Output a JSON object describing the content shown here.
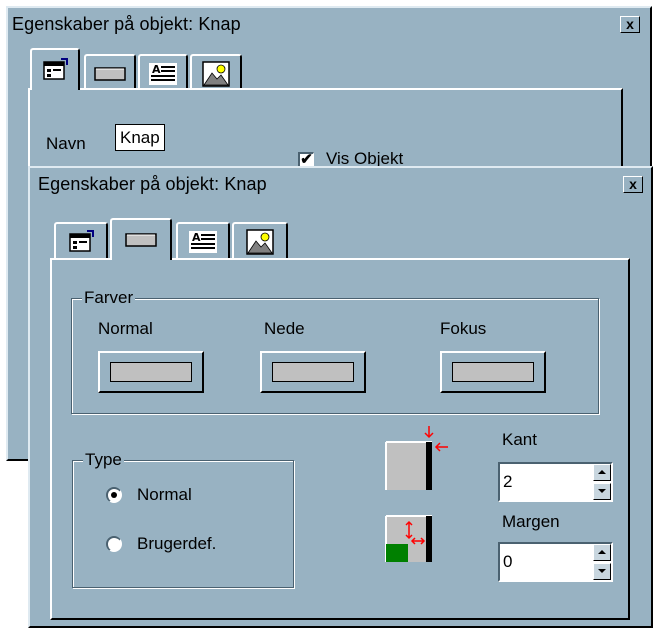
{
  "back_window": {
    "title": "Egenskaber på objekt: Knap",
    "close_label": "x",
    "name_label": "Navn",
    "name_value": "Knap",
    "show_checkbox_label": "Vis Objekt",
    "show_checked": true
  },
  "front_window": {
    "title": "Egenskaber på objekt: Knap",
    "close_label": "x",
    "tabs": [
      {
        "icon": "properties-icon"
      },
      {
        "icon": "button-icon",
        "active": true
      },
      {
        "icon": "text-align-icon"
      },
      {
        "icon": "picture-icon"
      }
    ],
    "colors_group": {
      "label": "Farver",
      "normal_label": "Normal",
      "down_label": "Nede",
      "focus_label": "Fokus",
      "swatch_color": "#c0c0c0"
    },
    "type_group": {
      "label": "Type",
      "options": [
        {
          "label": "Normal",
          "selected": true
        },
        {
          "label": "Brugerdef.",
          "selected": false
        }
      ]
    },
    "border_label": "Kant",
    "border_value": "2",
    "margin_label": "Margen",
    "margin_value": "0"
  },
  "colors": {
    "window_bg": "#98b2c2",
    "arrow_red": "#ff0000",
    "margin_green": "#008000"
  }
}
